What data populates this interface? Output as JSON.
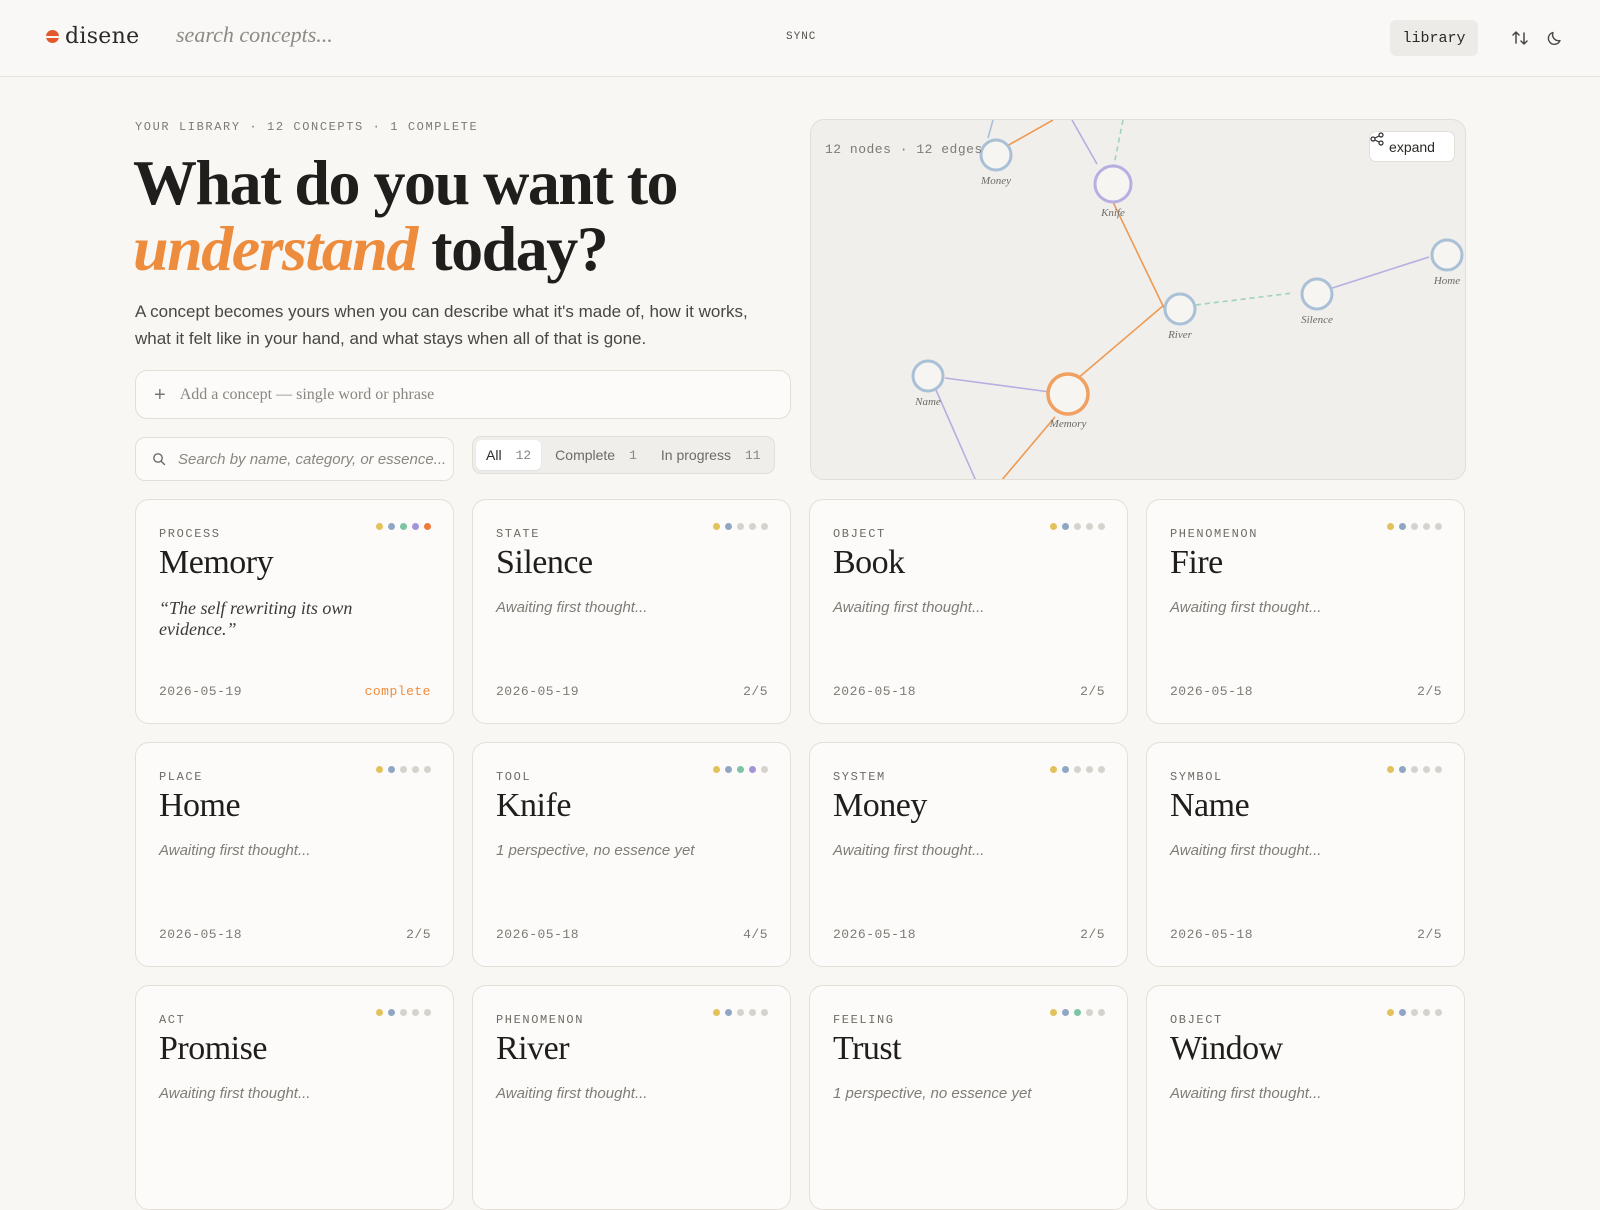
{
  "header": {
    "brand": "disene",
    "search_placeholder": "search concepts...",
    "sync_label": "SYNC",
    "library_label": "library",
    "icons": [
      "sort-arrows-icon",
      "moon-icon"
    ]
  },
  "hero": {
    "eyebrow": "YOUR LIBRARY · 12 CONCEPTS · 1 COMPLETE",
    "title_line1": "What do you want to",
    "title_accent": "understand",
    "title_end": "today?",
    "lead": "A concept becomes yours when you can describe what it's made of, how it works, what it felt like in your hand, and what stays when all of that is gone.",
    "add_placeholder": "Add a concept — single word or phrase",
    "search_placeholder": "Search by name, category, or essence..."
  },
  "filters": [
    {
      "label": "All",
      "count": "12",
      "active": true
    },
    {
      "label": "Complete",
      "count": "1",
      "active": false
    },
    {
      "label": "In progress",
      "count": "11",
      "active": false
    }
  ],
  "graph": {
    "stats": "12 nodes · 12 edges",
    "expand_label": "expand",
    "node_labels": {
      "money": "Money",
      "knife": "Knife",
      "home": "Home",
      "river": "River",
      "silence": "Silence",
      "name": "Name",
      "memory": "Memory"
    }
  },
  "colors": {
    "accent": "#ee8c3e",
    "dot_yellow": "#e2c25a",
    "dot_blue": "#8fa6c4",
    "dot_green": "#7cc4a4",
    "dot_purple": "#a594d8",
    "dot_orange": "#ef7b3b",
    "dot_empty": "#d6d3ce"
  },
  "cards": [
    {
      "category": "PROCESS",
      "title": "Memory",
      "desc": "“The self rewriting its own evidence.”",
      "date": "2026-05-19",
      "progress": "complete",
      "steps": 5
    },
    {
      "category": "STATE",
      "title": "Silence",
      "desc": "Awaiting first thought...",
      "date": "2026-05-19",
      "progress": "2/5",
      "steps": 2
    },
    {
      "category": "OBJECT",
      "title": "Book",
      "desc": "Awaiting first thought...",
      "date": "2026-05-18",
      "progress": "2/5",
      "steps": 2
    },
    {
      "category": "PHENOMENON",
      "title": "Fire",
      "desc": "Awaiting first thought...",
      "date": "2026-05-18",
      "progress": "2/5",
      "steps": 2
    },
    {
      "category": "PLACE",
      "title": "Home",
      "desc": "Awaiting first thought...",
      "date": "2026-05-18",
      "progress": "2/5",
      "steps": 2
    },
    {
      "category": "TOOL",
      "title": "Knife",
      "desc": "1 perspective, no essence yet",
      "date": "2026-05-18",
      "progress": "4/5",
      "steps": 4
    },
    {
      "category": "SYSTEM",
      "title": "Money",
      "desc": "Awaiting first thought...",
      "date": "2026-05-18",
      "progress": "2/5",
      "steps": 2
    },
    {
      "category": "SYMBOL",
      "title": "Name",
      "desc": "Awaiting first thought...",
      "date": "2026-05-18",
      "progress": "2/5",
      "steps": 2
    },
    {
      "category": "ACT",
      "title": "Promise",
      "desc": "Awaiting first thought...",
      "date": "",
      "progress": "",
      "steps": 2
    },
    {
      "category": "PHENOMENON",
      "title": "River",
      "desc": "Awaiting first thought...",
      "date": "",
      "progress": "",
      "steps": 2
    },
    {
      "category": "FEELING",
      "title": "Trust",
      "desc": "1 perspective, no essence yet",
      "date": "",
      "progress": "",
      "steps": 3
    },
    {
      "category": "OBJECT",
      "title": "Window",
      "desc": "Awaiting first thought...",
      "date": "",
      "progress": "",
      "steps": 2
    }
  ]
}
